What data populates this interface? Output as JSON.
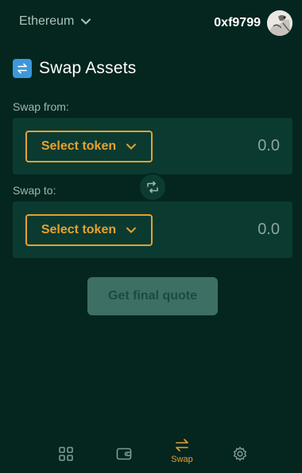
{
  "header": {
    "network_label": "Ethereum",
    "account_address": "0xf9799"
  },
  "page": {
    "title": "Swap Assets"
  },
  "swap_from": {
    "label": "Swap from:",
    "token_button_label": "Select token",
    "amount": "0.0"
  },
  "swap_to": {
    "label": "Swap to:",
    "token_button_label": "Select token",
    "amount": "0.0"
  },
  "quote_button_label": "Get final quote",
  "nav": {
    "items": [
      {
        "icon": "grid-icon",
        "label": ""
      },
      {
        "icon": "wallet-icon",
        "label": ""
      },
      {
        "icon": "swap-arrows-icon",
        "label": "Swap",
        "active": true
      },
      {
        "icon": "gear-icon",
        "label": ""
      }
    ]
  },
  "colors": {
    "background": "#04261f",
    "panel": "#0b3a31",
    "accent": "#e5a12e",
    "muted_text": "#9db8b0",
    "disabled_button": "#3d6f65"
  }
}
